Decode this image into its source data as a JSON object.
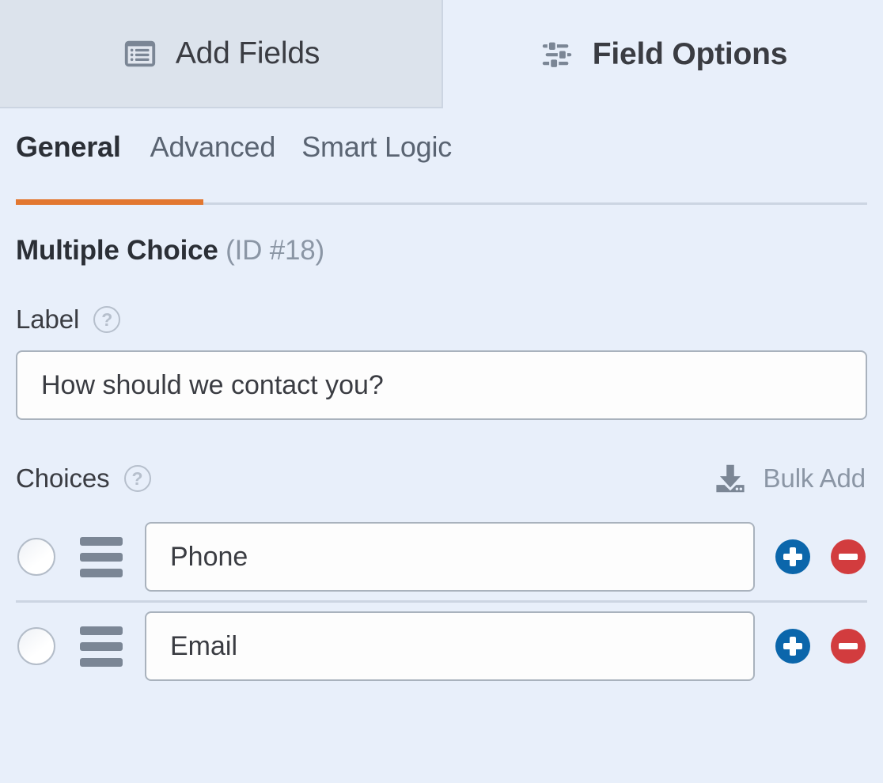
{
  "colors": {
    "accent_orange": "#e27730",
    "panel_bg": "#e8effa",
    "inactive_tab_bg": "#dce3ec",
    "add_button_blue": "#0b66ab",
    "remove_button_red": "#d23c3e",
    "muted_text": "#8b96a5",
    "divider": "#ccd5e2"
  },
  "top_tabs": [
    {
      "label": "Add Fields",
      "icon": "form-list-icon",
      "active": false
    },
    {
      "label": "Field Options",
      "icon": "sliders-icon",
      "active": true
    }
  ],
  "sub_tabs": [
    {
      "label": "General",
      "active": true
    },
    {
      "label": "Advanced",
      "active": false
    },
    {
      "label": "Smart Logic",
      "active": false
    }
  ],
  "field": {
    "type_title": "Multiple Choice",
    "id_text": "(ID #18)"
  },
  "label_section": {
    "title": "Label",
    "help_glyph": "?",
    "value": "How should we contact you?",
    "placeholder": ""
  },
  "choices_section": {
    "title": "Choices",
    "help_glyph": "?",
    "bulk_add_label": "Bulk Add",
    "bulk_add_icon": "import-download-icon",
    "rows": [
      {
        "value": "Phone",
        "selected": false,
        "add_label": "+",
        "remove_label": "−"
      },
      {
        "value": "Email",
        "selected": false,
        "add_label": "+",
        "remove_label": "−"
      }
    ]
  }
}
